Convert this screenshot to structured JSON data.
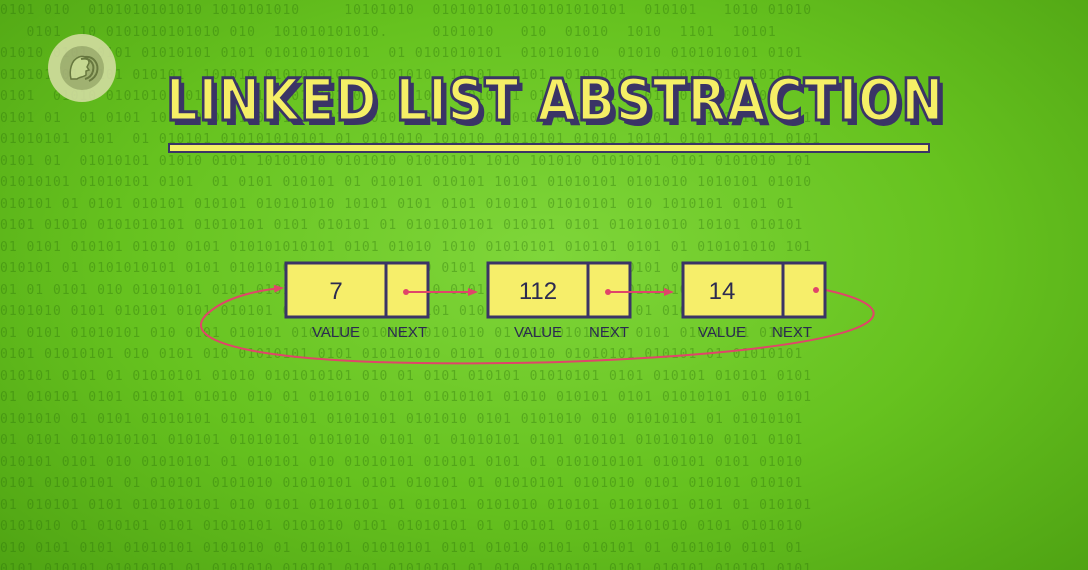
{
  "title": "LINKED LIST ABSTRACTION",
  "logo_icon": "pbs-head-icon",
  "colors": {
    "background": "#66c21f",
    "node_fill": "#f6ee6a",
    "node_stroke": "#3a3466",
    "arrow": "#e0456a",
    "title_fill": "#f5ef66"
  },
  "labels": {
    "value": "VALUE",
    "next": "NEXT"
  },
  "nodes": [
    {
      "value": "7"
    },
    {
      "value": "112"
    },
    {
      "value": "14"
    }
  ],
  "binary_rows": [
    "0101 010  0101010101010 1010101010     10101010  0101010101010101010101  010101   1010 01010",
    "   0101  10 0101010101010 010  101010101010.     0101010   010  01010  1010  1101  10101",
    "01010 0101 0101 01010101 0101 010101010101  01 0101010101  010101010  01010 0101010101 0101",
    "010101 01 0101 010101  101010 0101010101  0101010  10101  0101  01010101  1010101010 10101",
    "0101  01010 0101010  010101 0101 010101 0101010101 01010101 01010 010101 0101010 1010101",
    "0101 01  01 0101 10101010101 010101010101 01010101 010101 0101 0101010 1010101 01010101 0101",
    "01010101 0101  01 010101 010101010101 01 0101010 101010 01010101 01010 10101 0101 010101 0101",
    "0101 01  01010101 01010 0101 10101010 0101010 01010101 1010 101010 01010101 0101 0101010 101",
    "01010101 01010101 0101  01 0101 010101 01 010101 010101 10101 01010101 0101010 1010101 01010",
    "010101 01 0101 010101 010101 010101010 10101 0101 0101 010101 01010101 010 1010101 0101 01",
    "0101 01010 0101010101 01010101 0101 010101 01 0101010101 010101 0101 010101010 10101 010101",
    "01 0101 010101 01010 0101 010101010101 0101 01010 1010 01010101 010101 0101 01 010101010 101",
    "010101 01 0101010101 0101 01010101 0101 010101010 0101 010101 01010101 0101 010101 01 01010",
    "01 01 0101 010 01010101 0101 010101 01010101 01010 010101 0101010101 0101010101 0101 010 101",
    "0101010 0101 010101 0101 010101 01 0101010 01010101 010 01010101 010101 01 010101 01010 0101",
    "01 0101 01010101 010 0101 010101 0101010 010101 0101010 01 010 01010101 0101 01010101 010 01",
    "0101 01010101 010 0101 010 01010101 0101 010101010 0101 0101010 01010101 010101 01 01010101",
    "010101 0101 01 01010101 01010 0101010101 010 01 0101 010101 01010101 0101 010101 010101 0101",
    "01 010101 0101 010101 01010 010 01 0101010 0101 01010101 01010 010101 0101 01010101 010 0101",
    "0101010 01 0101 01010101 0101 010101 01010101 0101010 0101 0101010 010 01010101 01 01010101",
    "01 0101 0101010101 010101 01010101 0101010 0101 01 01010101 0101 010101 010101010 0101 0101",
    "010101 0101 010 01010101 01 010101 010 01010101 010101 0101 01 0101010101 010101 0101 01010",
    "0101 01010101 01 010101 0101010 01010101 0101 010101 01 01010101 0101010 0101 010101 010101",
    "01 010101 0101 0101010101 010 0101 01010101 01 010101 0101010 010101 01010101 0101 01 010101",
    "0101010 01 010101 0101 01010101 0101010 0101 01010101 01 010101 0101 010101010 0101 0101010",
    "010 0101 0101 01010101 0101010 01 010101 01010101 0101 01010 0101 010101 01 0101010 0101 01",
    "0101 010101 01010101 01 0101010 010101 0101 01010101 01 010 01010101 0101 010101 010101 0101"
  ]
}
